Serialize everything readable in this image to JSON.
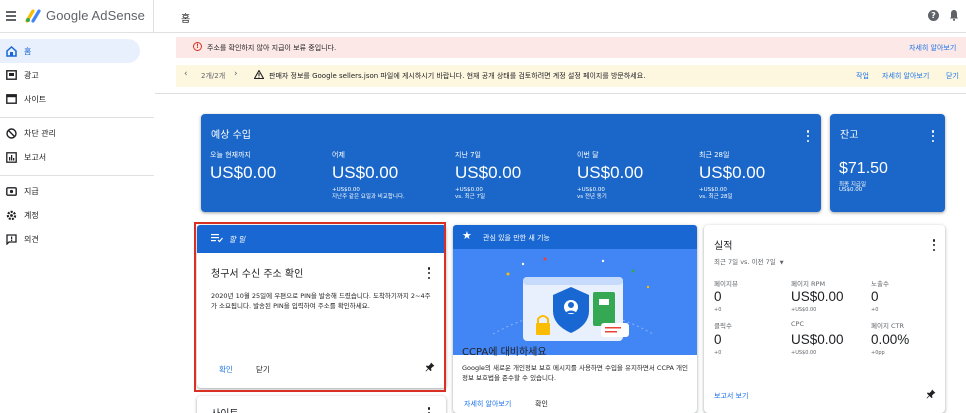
{
  "header": {
    "brand": "Google AdSense",
    "crumb": "홈",
    "help_icon": "help-icon",
    "bell_icon": "bell-icon"
  },
  "sidebar": {
    "items": [
      {
        "label": "홈",
        "icon": "home-icon",
        "active": true
      },
      {
        "label": "광고",
        "icon": "ads-icon"
      },
      {
        "label": "사이트",
        "icon": "sites-icon"
      },
      {
        "label": "차단 관리",
        "icon": "block-icon"
      },
      {
        "label": "보고서",
        "icon": "report-icon"
      },
      {
        "label": "지급",
        "icon": "payment-icon"
      },
      {
        "label": "계정",
        "icon": "settings-icon"
      },
      {
        "label": "의견",
        "icon": "feedback-icon"
      }
    ]
  },
  "alerts": {
    "red": {
      "text": "주소를 확인하지 않아 지급이 보류 중입니다.",
      "link": "자세히 알아보기"
    },
    "yellow": {
      "pager": "2개/2개",
      "text": "판매자 정보를 Google sellers.json 파일에 게시하시기 바랍니다. 현재 공개 상태를 검토하려면 계정 설정 페이지를 방문하세요.",
      "action": "작업",
      "link": "자세히 알아보기",
      "close": "닫기"
    }
  },
  "estimated": {
    "title": "예상 수입",
    "cols": [
      {
        "label": "오늘 현재까지",
        "value": "US$0.00",
        "sub1": "",
        "sub2": ""
      },
      {
        "label": "어제",
        "value": "US$0.00",
        "sub1": "+US$0.00",
        "sub2": "지난주 같은 요일과 비교합니다."
      },
      {
        "label": "지난 7일",
        "value": "US$0.00",
        "sub1": "+US$0.00",
        "sub2": "vs. 최근 7일"
      },
      {
        "label": "이번 달",
        "value": "US$0.00",
        "sub1": "+US$0.00",
        "sub2": "vs 전년 동기"
      },
      {
        "label": "최근 28일",
        "value": "US$0.00",
        "sub1": "+US$0.00",
        "sub2": "vs. 최근 28일"
      }
    ]
  },
  "balance": {
    "title": "잔고",
    "value": "$71.50",
    "label": "최종 지급일",
    "sub": "US$0.00"
  },
  "task": {
    "header": "할 일",
    "title": "청구서 수신 주소 확인",
    "body": "2020년 10월 25일에 우편으로 PIN을 발송해 드렸습니다. 도착하기까지 2~4주가 소요됩니다. 발송된 PIN을 입력하여 주소를 확인하세요.",
    "confirm": "확인",
    "close": "닫기"
  },
  "feature": {
    "header": "관심 있을 만한 새 기능",
    "title": "CCPA에 대비하세요",
    "body": "Google의 새로운 개인정보 보호 메시지를 사용하면 수입을 유지하면서 CCPA 개인정보 보호법을 준수할 수 있습니다.",
    "link": "자세히 알아보기",
    "confirm": "확인"
  },
  "performance": {
    "title": "실적",
    "period": "최근 7일 vs. 이전 7일",
    "metrics": [
      {
        "label": "페이지뷰",
        "value": "0",
        "sub": "+0"
      },
      {
        "label": "페이지 RPM",
        "value": "US$0.00",
        "sub": "+US$0.00"
      },
      {
        "label": "노출수",
        "value": "0",
        "sub": "+0"
      },
      {
        "label": "클릭수",
        "value": "0",
        "sub": "+0"
      },
      {
        "label": "CPC",
        "value": "US$0.00",
        "sub": "+US$0.00"
      },
      {
        "label": "페이지 CTR",
        "value": "0.00%",
        "sub": "+0pp"
      }
    ],
    "link": "보고서 보기"
  },
  "sites": {
    "title": "사이트"
  },
  "colors": {
    "primary": "#1967d2",
    "card_blue": "#1a67c9",
    "alert_red": "#fce8e6",
    "alert_yellow": "#fef7e0",
    "highlight": "#d93025"
  }
}
